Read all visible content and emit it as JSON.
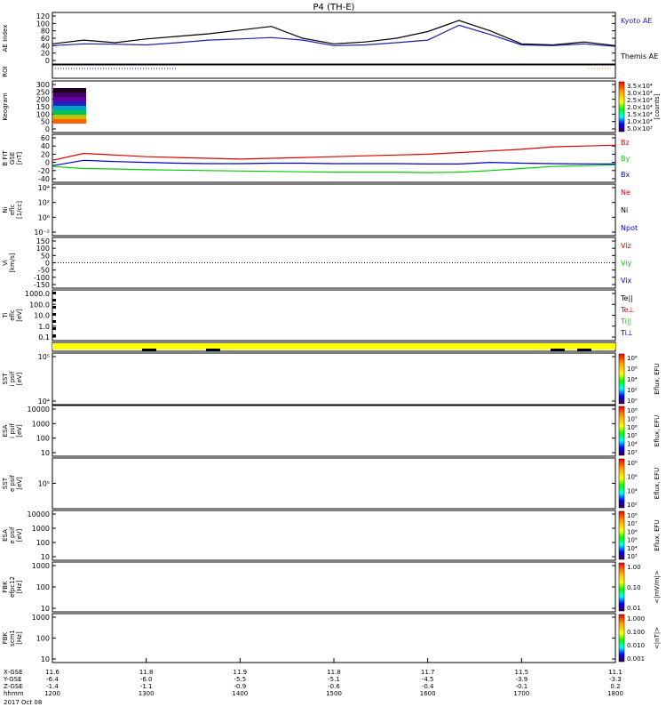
{
  "title": "P4 (TH-E)",
  "date": "2017 Oct 08",
  "colors": {
    "kyoto": "#1f1fa8",
    "themis": "#000000",
    "red": "#e00000",
    "green": "#00d000",
    "blue": "#0000d0",
    "yellow": "#ffff00",
    "black": "#000000"
  },
  "panels": [
    {
      "ylabel": [
        "AE Index"
      ],
      "yticks": [
        "120",
        "100",
        "80",
        "60",
        "40",
        "20",
        "0"
      ],
      "legend": [
        "Kyoto AE",
        "Themis AE"
      ],
      "legend_colors": [
        "#1f1fa8",
        "#000000"
      ]
    },
    {
      "ylabel": [
        "ROI"
      ],
      "yticks": [],
      "legend": []
    },
    {
      "ylabel": [
        "Keogram"
      ],
      "yticks": [
        "300",
        "250",
        "200",
        "150",
        "100",
        "50",
        "0"
      ],
      "colorbar": {
        "labels": [
          "3.5×10⁴",
          "3.0×10⁴",
          "2.5×10⁴",
          "2.0×10⁴",
          "1.5×10⁴",
          "1.0×10⁴",
          "5.0×10³"
        ],
        "unit": "[counts]"
      }
    },
    {
      "ylabel": [
        "B FIT",
        "GSE",
        "[nT]"
      ],
      "yticks": [
        "60",
        "40",
        "20",
        "0",
        "-20",
        "-40"
      ],
      "legend": [
        "Bz",
        "By",
        "Bx"
      ],
      "legend_colors": [
        "#e00000",
        "#00d000",
        "#0000d0"
      ]
    },
    {
      "ylabel": [
        "Ni",
        "eflc",
        "[1/cc]"
      ],
      "yticks": [
        "10⁴",
        "10²",
        "10⁰",
        "10⁻²"
      ],
      "legend": [
        "Ne",
        "Ni",
        "Npot"
      ],
      "legend_colors": [
        "#e00000",
        "#000000",
        "#0000d0"
      ]
    },
    {
      "ylabel": [
        "Vi",
        "[km/s]"
      ],
      "yticks": [
        "150",
        "100",
        "50",
        "0",
        "-50",
        "-100",
        "-150"
      ],
      "legend": [
        "Viz",
        "Viy",
        "Vix"
      ],
      "legend_colors": [
        "#e00000",
        "#00d000",
        "#0000d0"
      ]
    },
    {
      "ylabel": [
        "Ti",
        "eflc",
        "[eV]"
      ],
      "yticks": [
        "1000.0",
        "100.0",
        "10.0",
        "1.0",
        "0.1"
      ],
      "legend": [
        "Te||",
        "Te⊥",
        "Ti||",
        "Ti⊥"
      ],
      "legend_colors": [
        "#000000",
        "#e00000",
        "#00d000",
        "#0000d0"
      ]
    },
    {
      "ylabel": [],
      "yticks": [],
      "legend": []
    },
    {
      "ylabel": [
        "SST",
        "i psif",
        "[eV]"
      ],
      "yticks": [
        "10⁵",
        "10⁴"
      ],
      "colorbar": {
        "labels": [
          "10⁸",
          "10⁶",
          "10⁴",
          "10²",
          "10⁰"
        ],
        "unit": "Eflux, EFU"
      }
    },
    {
      "ylabel": [
        "ESA",
        "i psif",
        "[eV]"
      ],
      "yticks": [
        "10000",
        "1000",
        "100",
        "10"
      ],
      "colorbar": {
        "labels": [
          "10⁸",
          "10⁷",
          "10⁶",
          "10⁵",
          "10⁴",
          "10³"
        ],
        "unit": "Eflux, EFU"
      }
    },
    {
      "ylabel": [
        "SST",
        "e psif",
        "[eV]"
      ],
      "yticks": [
        "10⁵"
      ],
      "colorbar": {
        "labels": [
          "10⁸",
          "10⁶",
          "10⁴",
          "10²"
        ],
        "unit": "Eflux, EFU"
      }
    },
    {
      "ylabel": [
        "ESA",
        "e psif",
        "[eV]"
      ],
      "yticks": [
        "10000",
        "1000",
        "100",
        "10"
      ],
      "colorbar": {
        "labels": [
          "10⁸",
          "10⁷",
          "10⁶",
          "10⁵",
          "10⁴",
          "10³"
        ],
        "unit": "Eflux, EFU"
      }
    },
    {
      "ylabel": [
        "FBK",
        "efpc12",
        "[Hz]"
      ],
      "yticks": [
        "1000",
        "100",
        "10"
      ],
      "colorbar": {
        "labels": [
          "1.00",
          "0.10",
          "0.01"
        ],
        "unit": "<|mV/m|>"
      }
    },
    {
      "ylabel": [
        "FBK",
        "scm1",
        "[Hz]"
      ],
      "yticks": [
        "1000",
        "100",
        "10"
      ],
      "colorbar": {
        "labels": [
          "1.000",
          "0.100",
          "0.010",
          "0.001"
        ],
        "unit": "<|nT|>"
      }
    }
  ],
  "xaxis": {
    "row_labels": [
      "X-GSE",
      "Y-GSE",
      "Z-GSE",
      "hhmm"
    ],
    "columns": [
      [
        "11.6",
        "-6.4",
        "-1.4",
        "1200"
      ],
      [
        "11.8",
        "-6.0",
        "-1.1",
        "1300"
      ],
      [
        "11.9",
        "-5.5",
        "-0.9",
        "1400"
      ],
      [
        "11.8",
        "-5.1",
        "-0.6",
        "1500"
      ],
      [
        "11.7",
        "-4.5",
        "-0.4",
        "1600"
      ],
      [
        "11.5",
        "-3.9",
        "-0.1",
        "1700"
      ],
      [
        "11.1",
        "-3.3",
        "0.2",
        "1800"
      ]
    ]
  },
  "chart_data": [
    {
      "type": "line",
      "title": "P4 (TH-E)",
      "ylabel": "AE Index",
      "ylim": [
        0,
        120
      ],
      "x": [
        "1200",
        "1220",
        "1240",
        "1300",
        "1320",
        "1340",
        "1400",
        "1420",
        "1440",
        "1500",
        "1520",
        "1540",
        "1600",
        "1620",
        "1640",
        "1700",
        "1720",
        "1740",
        "1800"
      ],
      "series": [
        {
          "name": "Kyoto AE",
          "values": [
            40,
            45,
            44,
            42,
            48,
            55,
            58,
            62,
            55,
            40,
            42,
            48,
            55,
            95,
            70,
            42,
            40,
            45,
            38
          ]
        },
        {
          "name": "Themis AE",
          "values": [
            45,
            55,
            48,
            58,
            65,
            72,
            82,
            92,
            60,
            45,
            50,
            60,
            78,
            108,
            80,
            45,
            42,
            50,
            40
          ]
        }
      ]
    },
    {
      "type": "line",
      "ylabel": "B FIT GSE [nT]",
      "ylim": [
        -40,
        60
      ],
      "x": [
        "1200",
        "1220",
        "1240",
        "1300",
        "1320",
        "1340",
        "1400",
        "1420",
        "1440",
        "1500",
        "1520",
        "1540",
        "1600",
        "1620",
        "1640",
        "1700",
        "1720",
        "1740",
        "1800"
      ],
      "series": [
        {
          "name": "Bz",
          "values": [
            5,
            22,
            18,
            14,
            12,
            10,
            8,
            10,
            12,
            14,
            16,
            18,
            20,
            24,
            28,
            32,
            38,
            40,
            42
          ]
        },
        {
          "name": "By",
          "values": [
            -10,
            -15,
            -16,
            -18,
            -19,
            -20,
            -21,
            -22,
            -23,
            -24,
            -24,
            -24,
            -25,
            -24,
            -20,
            -15,
            -10,
            -8,
            -6
          ]
        },
        {
          "name": "Bx",
          "values": [
            -8,
            5,
            2,
            0,
            -2,
            -3,
            -3,
            -2,
            -2,
            -3,
            -3,
            -3,
            -4,
            -4,
            0,
            -2,
            -3,
            -4,
            -4
          ]
        }
      ]
    }
  ]
}
